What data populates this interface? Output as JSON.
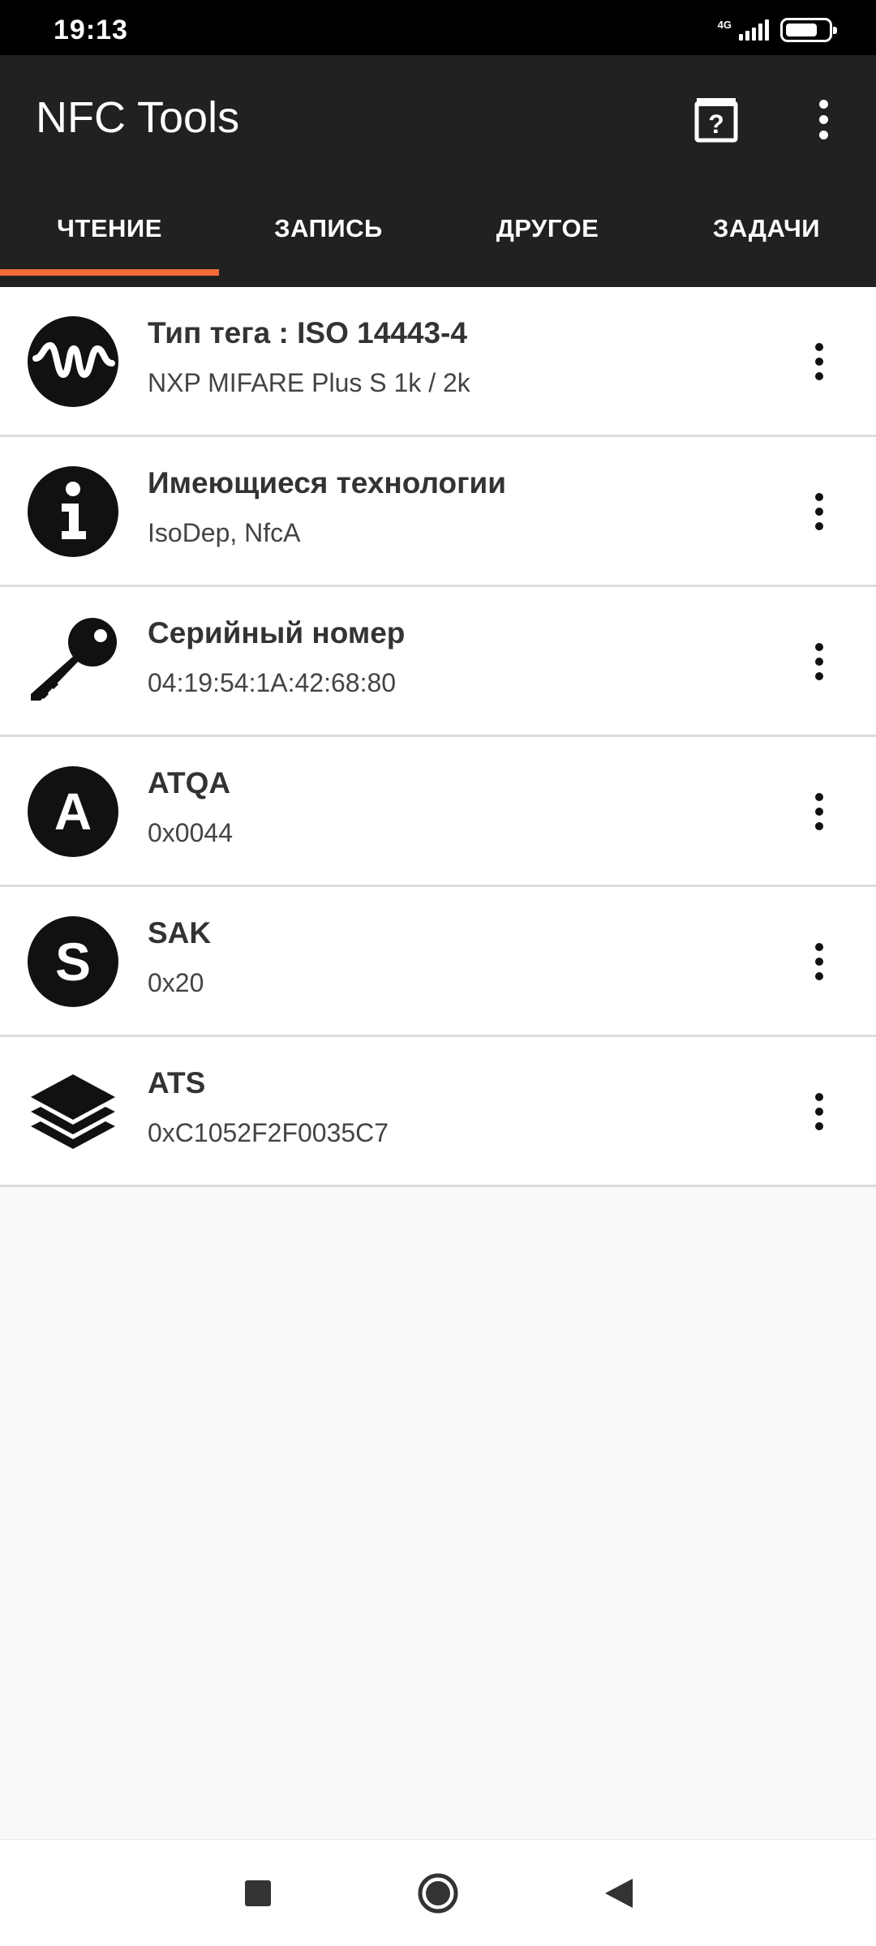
{
  "status_bar": {
    "time": "19:13",
    "network": "4G",
    "battery_level": 0.8
  },
  "app_bar": {
    "title": "NFC Tools",
    "help_icon": "help-box-icon",
    "overflow_icon": "more-vert-icon"
  },
  "tabs": [
    {
      "label": "ЧТЕНИЕ",
      "active": true
    },
    {
      "label": "ЗАПИСЬ",
      "active": false
    },
    {
      "label": "ДРУГОЕ",
      "active": false
    },
    {
      "label": "ЗАДАЧИ",
      "active": false
    }
  ],
  "colors": {
    "app_bar": "#212121",
    "accent": "#f26b38",
    "background": "#f9f9f9"
  },
  "records": [
    {
      "icon": "waveform-icon",
      "title": "Тип тега : ISO 14443-4",
      "value": "NXP MIFARE Plus S 1k / 2k"
    },
    {
      "icon": "info-icon",
      "title": "Имеющиеся технологии",
      "value": "IsoDep, NfcA"
    },
    {
      "icon": "key-icon",
      "title": "Серийный номер",
      "value": "04:19:54:1A:42:68:80"
    },
    {
      "icon": "letter-a-icon",
      "title": "ATQA",
      "value": "0x0044"
    },
    {
      "icon": "letter-s-icon",
      "title": "SAK",
      "value": "0x20"
    },
    {
      "icon": "layers-icon",
      "title": "ATS",
      "value": "0xC1052F2F0035C7"
    }
  ],
  "nav_bar": {
    "recent_icon": "recent-apps-icon",
    "home_icon": "home-icon",
    "back_icon": "back-icon"
  }
}
